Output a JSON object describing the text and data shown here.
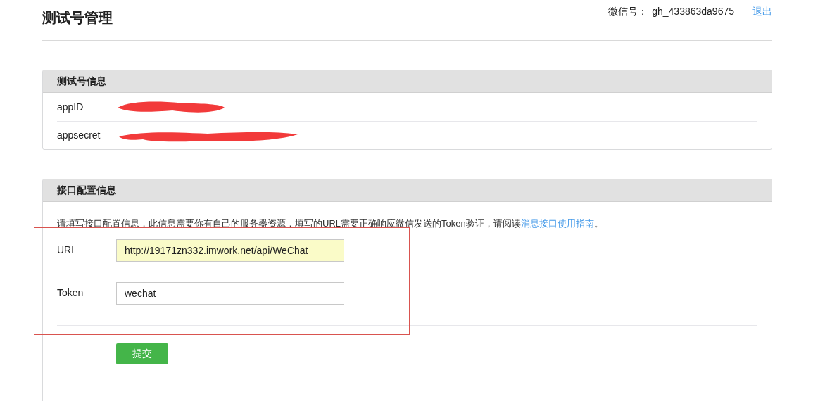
{
  "page": {
    "title": "测试号管理",
    "account_label": "微信号：",
    "account_id": "gh_433863da9675",
    "logout": "退出"
  },
  "test_account": {
    "heading": "测试号信息",
    "rows": [
      {
        "label": "appID",
        "redacted": true
      },
      {
        "label": "appsecret",
        "redacted": true
      }
    ]
  },
  "interface_config": {
    "heading": "接口配置信息",
    "intro": "请填写接口配置信息，此信息需要你有自己的服务器资源，填写的URL需要正确响应微信发送的Token验证，请阅读",
    "intro_link": "消息接口使用指南",
    "intro_end": "。",
    "fields": [
      {
        "label": "URL",
        "value": "http://19171zn332.imwork.net/api/WeChat",
        "autofilled": true
      },
      {
        "label": "Token",
        "value": "wechat",
        "autofilled": false
      }
    ],
    "submit": "提交"
  }
}
